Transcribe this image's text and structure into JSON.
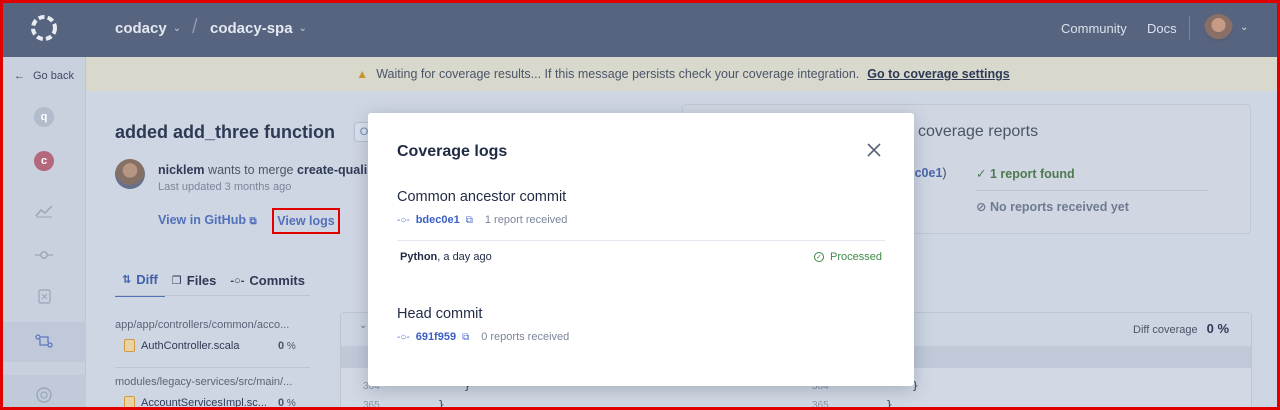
{
  "topbar": {
    "org": "codacy",
    "repo": "codacy-spa",
    "links": {
      "community": "Community",
      "docs": "Docs"
    }
  },
  "sidebar": {
    "go_back": "Go back",
    "letters": [
      "q",
      "c"
    ]
  },
  "banner": {
    "message": "Waiting for coverage results... If this message persists check your coverage integration.",
    "link": "Go to coverage settings"
  },
  "pull_request": {
    "title": "added add_three function",
    "badge": "O",
    "author": "nicklem",
    "action": "wants to merge",
    "branch": "create-quali",
    "updated": "Last updated 3 months ago",
    "github_link": "View in GitHub",
    "logs_button": "View logs"
  },
  "tabs": [
    {
      "label": "Diff",
      "active": true
    },
    {
      "label": "Files",
      "active": false
    },
    {
      "label": "Commits",
      "active": false
    }
  ],
  "files": [
    {
      "path": "app/app/controllers/common/acco...",
      "name": "AuthController.scala",
      "coverage": "0",
      "unit": "%"
    },
    {
      "path": "modules/legacy-services/src/main/...",
      "name": "AccountServicesImpl.sc...",
      "coverage": "0",
      "unit": "%"
    }
  ],
  "diff": {
    "coverage_label": "Diff coverage",
    "coverage_value": "0 %",
    "lines": [
      {
        "left": "364",
        "right": "364",
        "code": "}"
      },
      {
        "left": "365",
        "right": "365",
        "code": "}"
      }
    ]
  },
  "coverage_panel": {
    "title": "coverage reports",
    "commit": "dec0e1",
    "found": "1 report found",
    "none": "No reports received yet"
  },
  "modal": {
    "title": "Coverage logs",
    "sections": [
      {
        "heading": "Common ancestor commit",
        "sha": "bdec0e1",
        "count": "1 report received",
        "language": "Python",
        "time": ", a day ago",
        "status": "Processed"
      },
      {
        "heading": "Head commit",
        "sha": "691f959",
        "count": "0 reports received"
      }
    ]
  },
  "colors": {
    "topbar": "#57647f",
    "accent": "#3a5fc4",
    "success": "#3d8a46",
    "highlight_border": "#e00000"
  }
}
